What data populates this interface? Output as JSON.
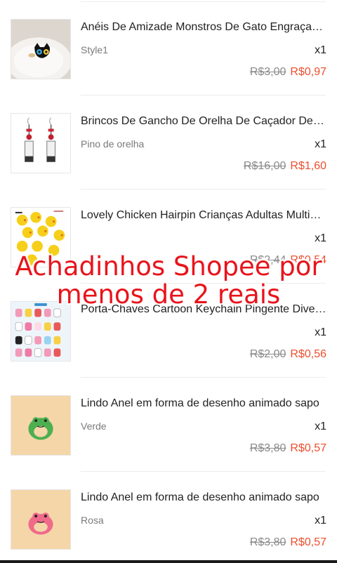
{
  "items": [
    {
      "name": "Anéis De Amizade Monstros De Gato Engraçados",
      "variant": "Style1",
      "qty": "x1",
      "old_price": "R$3,00",
      "new_price": "R$0,97",
      "thumb_icon": "cat-ring-thumbnail"
    },
    {
      "name": "Brincos De Gancho De Orelha De Caçador De Demônios",
      "variant": "Pino de orelha",
      "qty": "x1",
      "old_price": "R$16,00",
      "new_price": "R$1,60",
      "thumb_icon": "earrings-thumbnail"
    },
    {
      "name": "Lovely Chicken Hairpin Crianças Adultas Multicolor",
      "variant": "",
      "qty": "x1",
      "old_price": "R$2,44",
      "new_price": "R$0,54",
      "thumb_icon": "chicken-hairpin-thumbnail"
    },
    {
      "name": "Porta-Chaves Cartoon Keychain Pingente Diversos",
      "variant": "",
      "qty": "x1",
      "old_price": "R$2,00",
      "new_price": "R$0,56",
      "thumb_icon": "keychain-thumbnail"
    },
    {
      "name": "Lindo Anel em forma de desenho animado sapo",
      "variant": "Verde",
      "qty": "x1",
      "old_price": "R$3,80",
      "new_price": "R$0,57",
      "thumb_icon": "green-frog-ring-thumbnail"
    },
    {
      "name": "Lindo Anel em forma de desenho animado sapo",
      "variant": "Rosa",
      "qty": "x1",
      "old_price": "R$3,80",
      "new_price": "R$0,57",
      "thumb_icon": "pink-frog-ring-thumbnail"
    }
  ],
  "overlay": {
    "line1": "Achadinhos Shopee por",
    "line2": "menos de 2 reais"
  },
  "colors": {
    "price_accent": "#ee4d2d",
    "overlay_text": "#e8141b"
  }
}
